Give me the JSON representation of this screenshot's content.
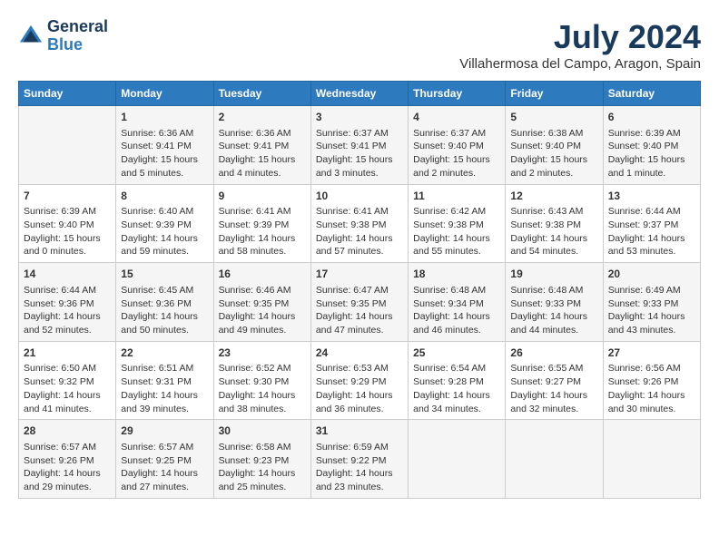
{
  "header": {
    "logo_line1": "General",
    "logo_line2": "Blue",
    "month_year": "July 2024",
    "location": "Villahermosa del Campo, Aragon, Spain"
  },
  "days_of_week": [
    "Sunday",
    "Monday",
    "Tuesday",
    "Wednesday",
    "Thursday",
    "Friday",
    "Saturday"
  ],
  "weeks": [
    [
      {
        "day": "",
        "info": ""
      },
      {
        "day": "1",
        "info": "Sunrise: 6:36 AM\nSunset: 9:41 PM\nDaylight: 15 hours\nand 5 minutes."
      },
      {
        "day": "2",
        "info": "Sunrise: 6:36 AM\nSunset: 9:41 PM\nDaylight: 15 hours\nand 4 minutes."
      },
      {
        "day": "3",
        "info": "Sunrise: 6:37 AM\nSunset: 9:41 PM\nDaylight: 15 hours\nand 3 minutes."
      },
      {
        "day": "4",
        "info": "Sunrise: 6:37 AM\nSunset: 9:40 PM\nDaylight: 15 hours\nand 2 minutes."
      },
      {
        "day": "5",
        "info": "Sunrise: 6:38 AM\nSunset: 9:40 PM\nDaylight: 15 hours\nand 2 minutes."
      },
      {
        "day": "6",
        "info": "Sunrise: 6:39 AM\nSunset: 9:40 PM\nDaylight: 15 hours\nand 1 minute."
      }
    ],
    [
      {
        "day": "7",
        "info": "Sunrise: 6:39 AM\nSunset: 9:40 PM\nDaylight: 15 hours\nand 0 minutes."
      },
      {
        "day": "8",
        "info": "Sunrise: 6:40 AM\nSunset: 9:39 PM\nDaylight: 14 hours\nand 59 minutes."
      },
      {
        "day": "9",
        "info": "Sunrise: 6:41 AM\nSunset: 9:39 PM\nDaylight: 14 hours\nand 58 minutes."
      },
      {
        "day": "10",
        "info": "Sunrise: 6:41 AM\nSunset: 9:38 PM\nDaylight: 14 hours\nand 57 minutes."
      },
      {
        "day": "11",
        "info": "Sunrise: 6:42 AM\nSunset: 9:38 PM\nDaylight: 14 hours\nand 55 minutes."
      },
      {
        "day": "12",
        "info": "Sunrise: 6:43 AM\nSunset: 9:38 PM\nDaylight: 14 hours\nand 54 minutes."
      },
      {
        "day": "13",
        "info": "Sunrise: 6:44 AM\nSunset: 9:37 PM\nDaylight: 14 hours\nand 53 minutes."
      }
    ],
    [
      {
        "day": "14",
        "info": "Sunrise: 6:44 AM\nSunset: 9:36 PM\nDaylight: 14 hours\nand 52 minutes."
      },
      {
        "day": "15",
        "info": "Sunrise: 6:45 AM\nSunset: 9:36 PM\nDaylight: 14 hours\nand 50 minutes."
      },
      {
        "day": "16",
        "info": "Sunrise: 6:46 AM\nSunset: 9:35 PM\nDaylight: 14 hours\nand 49 minutes."
      },
      {
        "day": "17",
        "info": "Sunrise: 6:47 AM\nSunset: 9:35 PM\nDaylight: 14 hours\nand 47 minutes."
      },
      {
        "day": "18",
        "info": "Sunrise: 6:48 AM\nSunset: 9:34 PM\nDaylight: 14 hours\nand 46 minutes."
      },
      {
        "day": "19",
        "info": "Sunrise: 6:48 AM\nSunset: 9:33 PM\nDaylight: 14 hours\nand 44 minutes."
      },
      {
        "day": "20",
        "info": "Sunrise: 6:49 AM\nSunset: 9:33 PM\nDaylight: 14 hours\nand 43 minutes."
      }
    ],
    [
      {
        "day": "21",
        "info": "Sunrise: 6:50 AM\nSunset: 9:32 PM\nDaylight: 14 hours\nand 41 minutes."
      },
      {
        "day": "22",
        "info": "Sunrise: 6:51 AM\nSunset: 9:31 PM\nDaylight: 14 hours\nand 39 minutes."
      },
      {
        "day": "23",
        "info": "Sunrise: 6:52 AM\nSunset: 9:30 PM\nDaylight: 14 hours\nand 38 minutes."
      },
      {
        "day": "24",
        "info": "Sunrise: 6:53 AM\nSunset: 9:29 PM\nDaylight: 14 hours\nand 36 minutes."
      },
      {
        "day": "25",
        "info": "Sunrise: 6:54 AM\nSunset: 9:28 PM\nDaylight: 14 hours\nand 34 minutes."
      },
      {
        "day": "26",
        "info": "Sunrise: 6:55 AM\nSunset: 9:27 PM\nDaylight: 14 hours\nand 32 minutes."
      },
      {
        "day": "27",
        "info": "Sunrise: 6:56 AM\nSunset: 9:26 PM\nDaylight: 14 hours\nand 30 minutes."
      }
    ],
    [
      {
        "day": "28",
        "info": "Sunrise: 6:57 AM\nSunset: 9:26 PM\nDaylight: 14 hours\nand 29 minutes."
      },
      {
        "day": "29",
        "info": "Sunrise: 6:57 AM\nSunset: 9:25 PM\nDaylight: 14 hours\nand 27 minutes."
      },
      {
        "day": "30",
        "info": "Sunrise: 6:58 AM\nSunset: 9:23 PM\nDaylight: 14 hours\nand 25 minutes."
      },
      {
        "day": "31",
        "info": "Sunrise: 6:59 AM\nSunset: 9:22 PM\nDaylight: 14 hours\nand 23 minutes."
      },
      {
        "day": "",
        "info": ""
      },
      {
        "day": "",
        "info": ""
      },
      {
        "day": "",
        "info": ""
      }
    ]
  ]
}
